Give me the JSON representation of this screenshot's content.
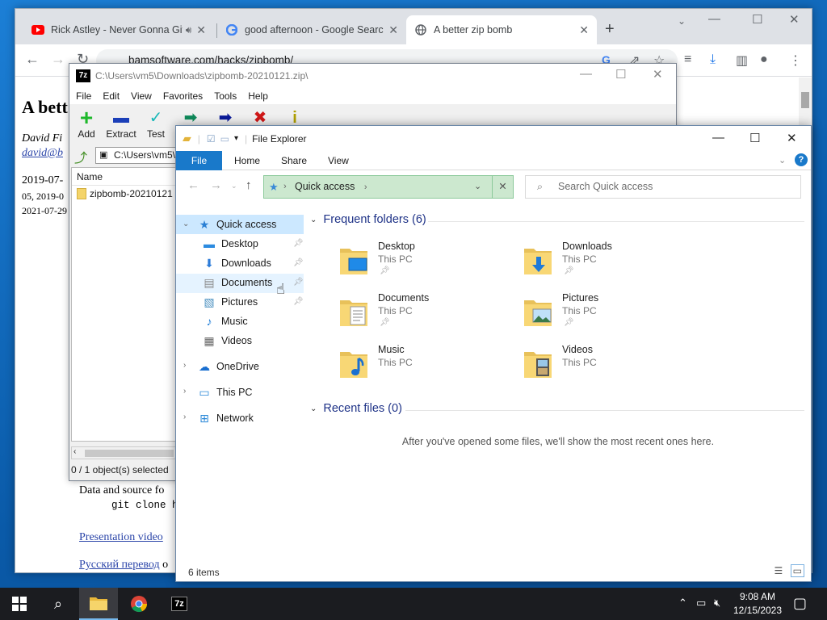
{
  "chrome": {
    "tabs": [
      {
        "title": "Rick Astley - Never Gonna Give You Up",
        "icon": "youtube-icon",
        "audio": true
      },
      {
        "title": "good afternoon - Google Search",
        "icon": "google-icon"
      },
      {
        "title": "A better zip bomb",
        "icon": "globe-icon",
        "active": true
      }
    ],
    "url": "bamsoftware.com/hacks/zipbomb/",
    "page": {
      "heading": "A bett",
      "author": "David Fi",
      "email": "david@b",
      "date1": "2019-07-",
      "date2": "05, 2019-0",
      "date3": "2021-07-29",
      "data_line": "Data and source fo",
      "git_line": "git clone h",
      "presentation_link": "Presentation video",
      "russian_link": "Русский перевод",
      "russian_suffix": "о"
    }
  },
  "sevenzip": {
    "title": "C:\\Users\\vm5\\Downloads\\zipbomb-20210121.zip\\",
    "menu": [
      "File",
      "Edit",
      "View",
      "Favorites",
      "Tools",
      "Help"
    ],
    "tools": [
      {
        "label": "Add",
        "glyph": "+",
        "color": "#1db82a"
      },
      {
        "label": "Extract",
        "glyph": "▬",
        "color": "#1b3fb8"
      },
      {
        "label": "Test",
        "glyph": "✓",
        "color": "#18b8b8"
      },
      {
        "label": "",
        "glyph": "➡",
        "color": "#0f8a5a"
      },
      {
        "label": "",
        "glyph": "➡",
        "color": "#0a1a9a"
      },
      {
        "label": "",
        "glyph": "✖",
        "color": "#d01818"
      },
      {
        "label": "",
        "glyph": "i",
        "color": "#b0a000"
      }
    ],
    "address": "C:\\Users\\vm5\\",
    "column_name": "Name",
    "item": "zipbomb-20210121",
    "status": "0 / 1 object(s) selected"
  },
  "explorer": {
    "title": "File Explorer",
    "ribbon": [
      "File",
      "Home",
      "Share",
      "View"
    ],
    "address": "Quick access",
    "search_placeholder": "Search Quick access",
    "nav": {
      "quick_access": "Quick access",
      "pinned": [
        "Desktop",
        "Downloads",
        "Documents",
        "Pictures"
      ],
      "unpinned": [
        "Music",
        "Videos"
      ],
      "onedrive": "OneDrive",
      "thispc": "This PC",
      "network": "Network"
    },
    "frequent_header": "Frequent folders (6)",
    "folders": [
      {
        "name": "Desktop",
        "sub": "This PC",
        "pinned": true,
        "overlay": "desktop"
      },
      {
        "name": "Downloads",
        "sub": "This PC",
        "pinned": true,
        "overlay": "downloads"
      },
      {
        "name": "Documents",
        "sub": "This PC",
        "pinned": true,
        "overlay": "documents"
      },
      {
        "name": "Pictures",
        "sub": "This PC",
        "pinned": true,
        "overlay": "pictures"
      },
      {
        "name": "Music",
        "sub": "This PC",
        "pinned": false,
        "overlay": "music"
      },
      {
        "name": "Videos",
        "sub": "This PC",
        "pinned": false,
        "overlay": "videos"
      }
    ],
    "recent_header": "Recent files (0)",
    "recent_empty": "After you've opened some files, we'll show the most recent ones here.",
    "status": "6 items"
  },
  "taskbar": {
    "time": "9:08 AM",
    "date": "12/15/2023"
  }
}
